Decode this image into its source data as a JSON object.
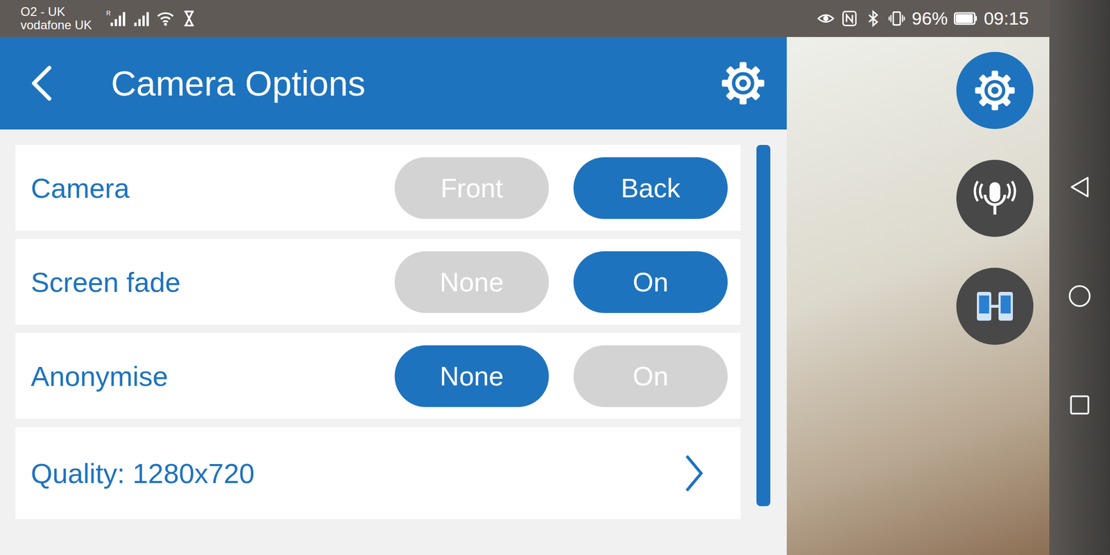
{
  "status_bar": {
    "carriers": [
      "O2 - UK",
      "vodafone UK"
    ],
    "roaming": "R",
    "battery": "96%",
    "battery_level": 0.96,
    "time": "09:15"
  },
  "header": {
    "title": "Camera Options"
  },
  "options": [
    {
      "kind": "toggle",
      "label": "Camera",
      "choices": [
        {
          "label": "Front",
          "selected": false
        },
        {
          "label": "Back",
          "selected": true
        }
      ]
    },
    {
      "kind": "toggle",
      "label": "Screen fade",
      "choices": [
        {
          "label": "None",
          "selected": false
        },
        {
          "label": "On",
          "selected": true
        }
      ]
    },
    {
      "kind": "toggle",
      "label": "Anonymise",
      "choices": [
        {
          "label": "None",
          "selected": true
        },
        {
          "label": "On",
          "selected": false
        }
      ]
    },
    {
      "kind": "link",
      "label": "Quality: 1280x720",
      "choices": []
    }
  ],
  "scrollbar": {
    "level": 1.0
  },
  "floating_buttons": [
    {
      "kind": "settings",
      "active": true
    },
    {
      "kind": "microphone",
      "active": false
    },
    {
      "kind": "switch-device",
      "active": false
    }
  ]
}
